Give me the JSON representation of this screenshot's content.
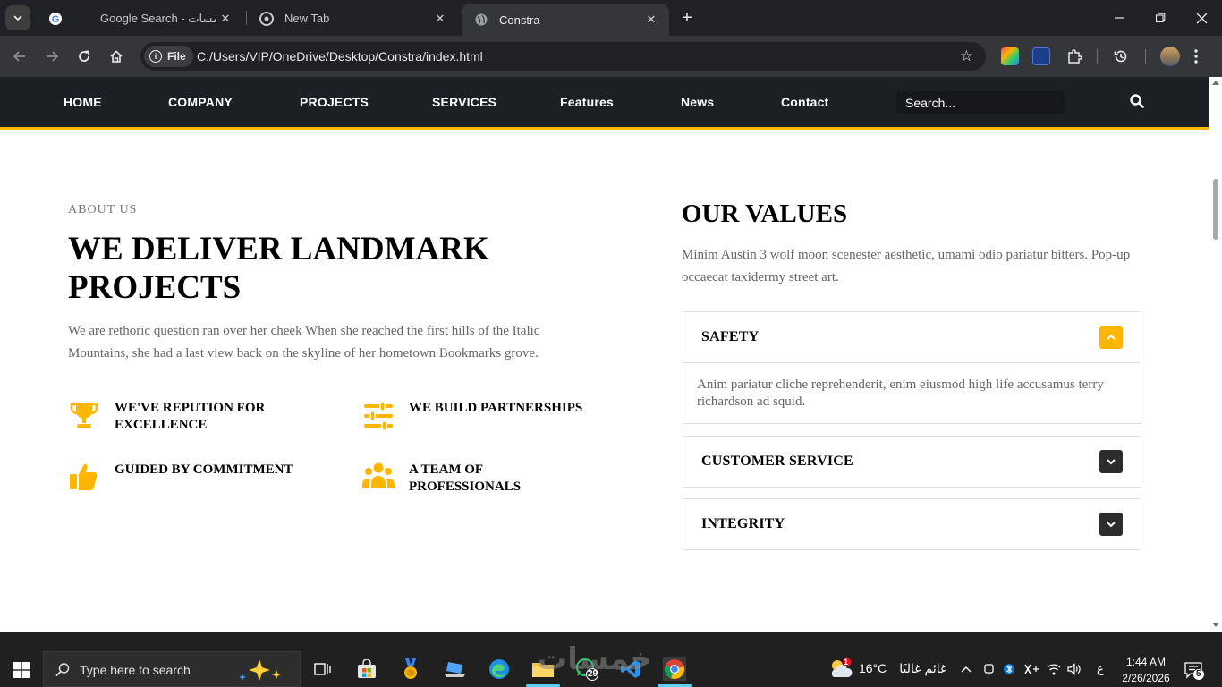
{
  "browser": {
    "tabs": [
      {
        "label": "Google Search - خمسات",
        "active": false
      },
      {
        "label": "New Tab",
        "active": false
      },
      {
        "label": "Constra",
        "active": true
      }
    ],
    "address": {
      "scheme_chip": "File",
      "url": "C:/Users/VIP/OneDrive/Desktop/Constra/index.html"
    }
  },
  "site": {
    "nav": {
      "links": [
        "HOME",
        "COMPANY",
        "PROJECTS",
        "SERVICES",
        "Features",
        "News",
        "Contact"
      ],
      "search_placeholder": "Search..."
    },
    "about": {
      "eyebrow": "ABOUT US",
      "headline": "WE DELIVER LANDMARK PROJECTS",
      "lead": "We are rethoric question ran over her cheek When she reached the first hills of the Italic Mountains, she had a last view back on the skyline of her hometown Bookmarks grove.",
      "features": [
        {
          "icon": "trophy-icon",
          "label": "WE'VE REPUTION FOR EXCELLENCE"
        },
        {
          "icon": "sliders-icon",
          "label": "WE BUILD PARTNERSHIPS"
        },
        {
          "icon": "thumbs-up-icon",
          "label": "GUIDED BY COMMITMENT"
        },
        {
          "icon": "users-icon",
          "label": "A TEAM OF PROFESSIONALS"
        }
      ]
    },
    "values": {
      "title": "OUR VALUES",
      "desc": "Minim Austin 3 wolf moon scenester aesthetic, umami odio pariatur bitters. Pop-up occaecat taxidermy street art.",
      "accordion": [
        {
          "title": "SAFETY",
          "open": true,
          "body": "Anim pariatur cliche reprehenderit, enim eiusmod high life accusamus terry richardson ad squid."
        },
        {
          "title": "CUSTOMER SERVICE",
          "open": false
        },
        {
          "title": "INTEGRITY",
          "open": false
        }
      ]
    },
    "accent_color": "#ffb600"
  },
  "taskbar": {
    "search_placeholder": "Type here to search",
    "whatsapp_badge": "29",
    "weather": {
      "temp": "16°C",
      "desc": "غائم غالبًا",
      "badge": "1"
    },
    "ime": "ع",
    "clock": {
      "time": "1:44 AM",
      "date": "2/26/2026"
    },
    "notifications": "5",
    "watermark": "خمسات"
  }
}
